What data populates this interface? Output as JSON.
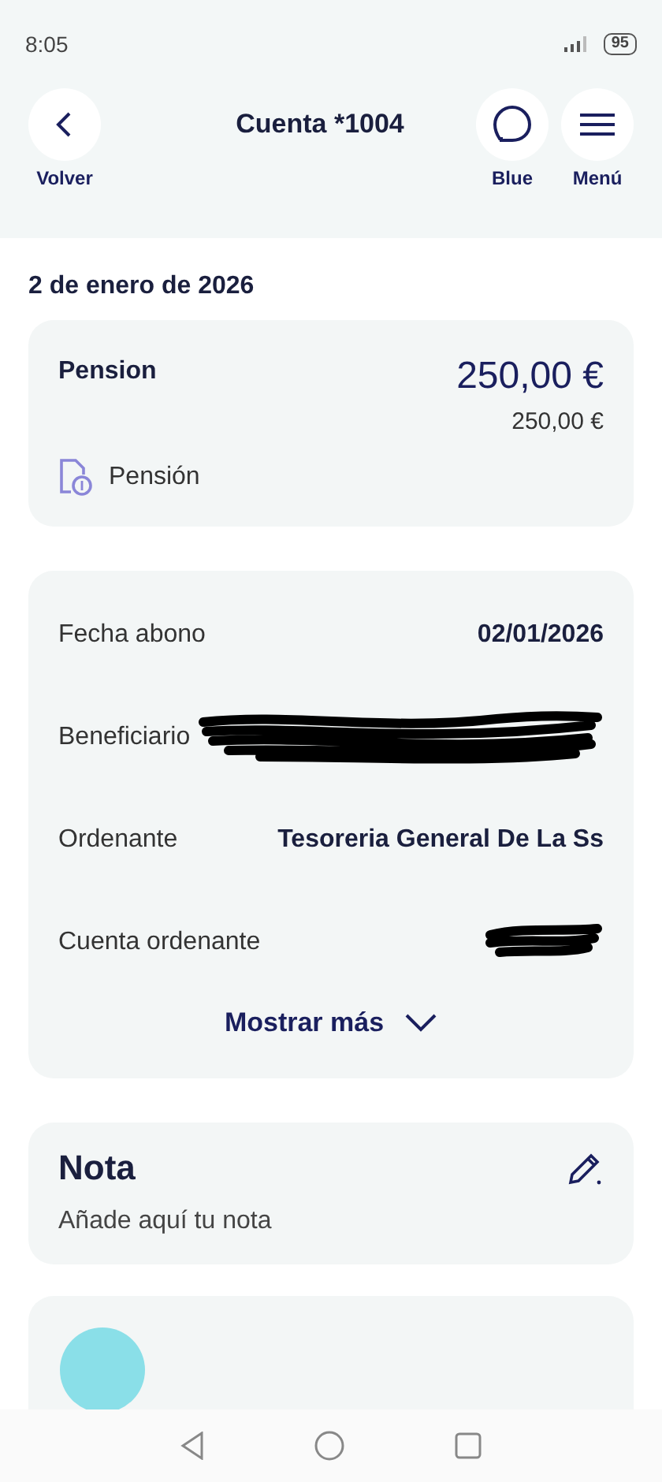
{
  "status_bar": {
    "time": "8:05",
    "battery": "95"
  },
  "header": {
    "title": "Cuenta *1004",
    "back": {
      "label": "Volver"
    },
    "actions": [
      {
        "kind": "chat",
        "label": "Blue"
      },
      {
        "kind": "menu",
        "label": "Menú"
      }
    ]
  },
  "date": "2 de enero de 2026",
  "summary": {
    "title": "Pension",
    "amount": "250,00 €",
    "secondary_amount": "250,00 €",
    "category": "Pensión"
  },
  "details": {
    "rows": [
      {
        "kind": "text",
        "label": "Fecha abono",
        "value": "02/01/2026"
      },
      {
        "kind": "redacted",
        "label": "Beneficiario"
      },
      {
        "kind": "text",
        "label": "Ordenante",
        "value": "Tesoreria General De La Ss"
      },
      {
        "kind": "redacted",
        "label": "Cuenta ordenante"
      }
    ],
    "show_more": "Mostrar más"
  },
  "note": {
    "title": "Nota",
    "placeholder": "Añade aquí tu nota"
  }
}
